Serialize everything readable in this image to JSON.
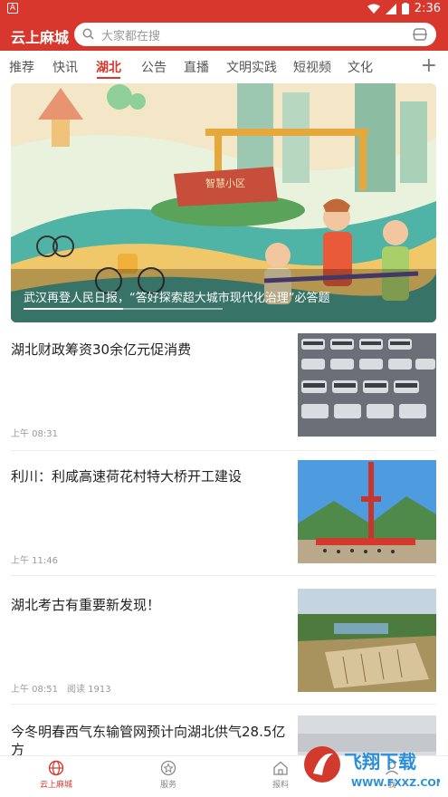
{
  "status": {
    "left_badge": "A",
    "time": "2:36"
  },
  "app": {
    "title": "云上麻城"
  },
  "search": {
    "placeholder": "大家都在搜"
  },
  "tabs": [
    {
      "label": "推荐"
    },
    {
      "label": "快讯"
    },
    {
      "label": "湖北",
      "active": true
    },
    {
      "label": "公告"
    },
    {
      "label": "直播"
    },
    {
      "label": "文明实践"
    },
    {
      "label": "短视频"
    },
    {
      "label": "文化"
    }
  ],
  "hero": {
    "caption": "武汉再登人民日报，“答好探索超大城市现代化治理”必答题",
    "sign_text": "智慧小区",
    "progress": 0.5
  },
  "news": [
    {
      "title": "湖北财政筹资30余亿元促消费",
      "time": "上午 08:31",
      "reads": ""
    },
    {
      "title": "利川：利咸高速荷花村特大桥开工建设",
      "time": "上午 11:46",
      "reads": ""
    },
    {
      "title": "湖北考古有重要新发现！",
      "time": "上午 08:51",
      "reads": "阅读 1913"
    },
    {
      "title": "今冬明春西气东输管网预计向湖北供气28.5亿方",
      "time": "",
      "reads": ""
    }
  ],
  "bottom_nav": [
    {
      "label": "云上麻城",
      "icon": "globe-icon",
      "active": true
    },
    {
      "label": "服务",
      "icon": "star-circle-icon"
    },
    {
      "label": "报料",
      "icon": "home-icon"
    },
    {
      "label": "我",
      "icon": "user-icon"
    }
  ],
  "watermark": {
    "text": "飞翔下载",
    "url": "WWW.FXXZ.COM"
  },
  "colors": {
    "brand": "#d7372c"
  }
}
